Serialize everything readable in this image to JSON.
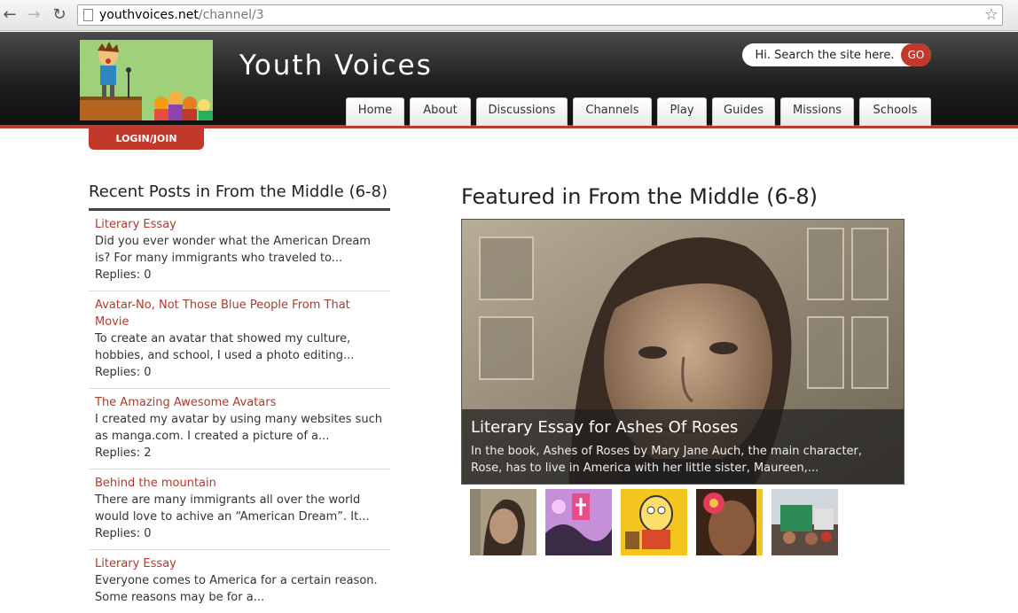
{
  "browser": {
    "url_host": "youthvoices.net",
    "url_path": "/channel/3"
  },
  "header": {
    "site_title": "Youth Voices",
    "search_placeholder": "Hi. Search the site here.",
    "go_label": "GO",
    "login_label": "LOGIN/JOIN",
    "tabs": [
      {
        "label": "Home"
      },
      {
        "label": "About"
      },
      {
        "label": "Discussions"
      },
      {
        "label": "Channels"
      },
      {
        "label": "Play"
      },
      {
        "label": "Guides"
      },
      {
        "label": "Missions"
      },
      {
        "label": "Schools"
      }
    ]
  },
  "recent": {
    "title": "Recent Posts in From the Middle (6-8)",
    "posts": [
      {
        "title": "Literary Essay",
        "excerpt": "Did you ever wonder what the American Dream is? For many immigrants who traveled to...",
        "replies": "Replies: 0"
      },
      {
        "title": "Avatar-No, Not Those Blue People From That Movie",
        "excerpt": "To create an avatar that showed my culture, hobbies, and school, I used a photo editing...",
        "replies": "Replies: 0"
      },
      {
        "title": "The Amazing Awesome Avatars",
        "excerpt": "I created my avatar by using many websites such as manga.com. I created a picture of a...",
        "replies": "Replies: 2"
      },
      {
        "title": "Behind the mountain",
        "excerpt": "There are many immigrants all over the world would love to achive an “American Dream”. It...",
        "replies": "Replies: 0"
      },
      {
        "title": "Literary Essay",
        "excerpt": "Everyone comes to America for a certain reason. Some reasons may be for a...",
        "replies": ""
      }
    ]
  },
  "featured": {
    "title": "Featured in From the Middle (6-8)",
    "caption_title": "Literary Essay for Ashes Of Roses",
    "caption_text": "In the book, Ashes of Roses by Mary Jane Auch, the main character, Rose, has to live in America with her little sister, Maureen,..."
  },
  "colors": {
    "accent": "#c0392b",
    "header_dark": "#1f1f1f",
    "link": "#b03a2e"
  }
}
